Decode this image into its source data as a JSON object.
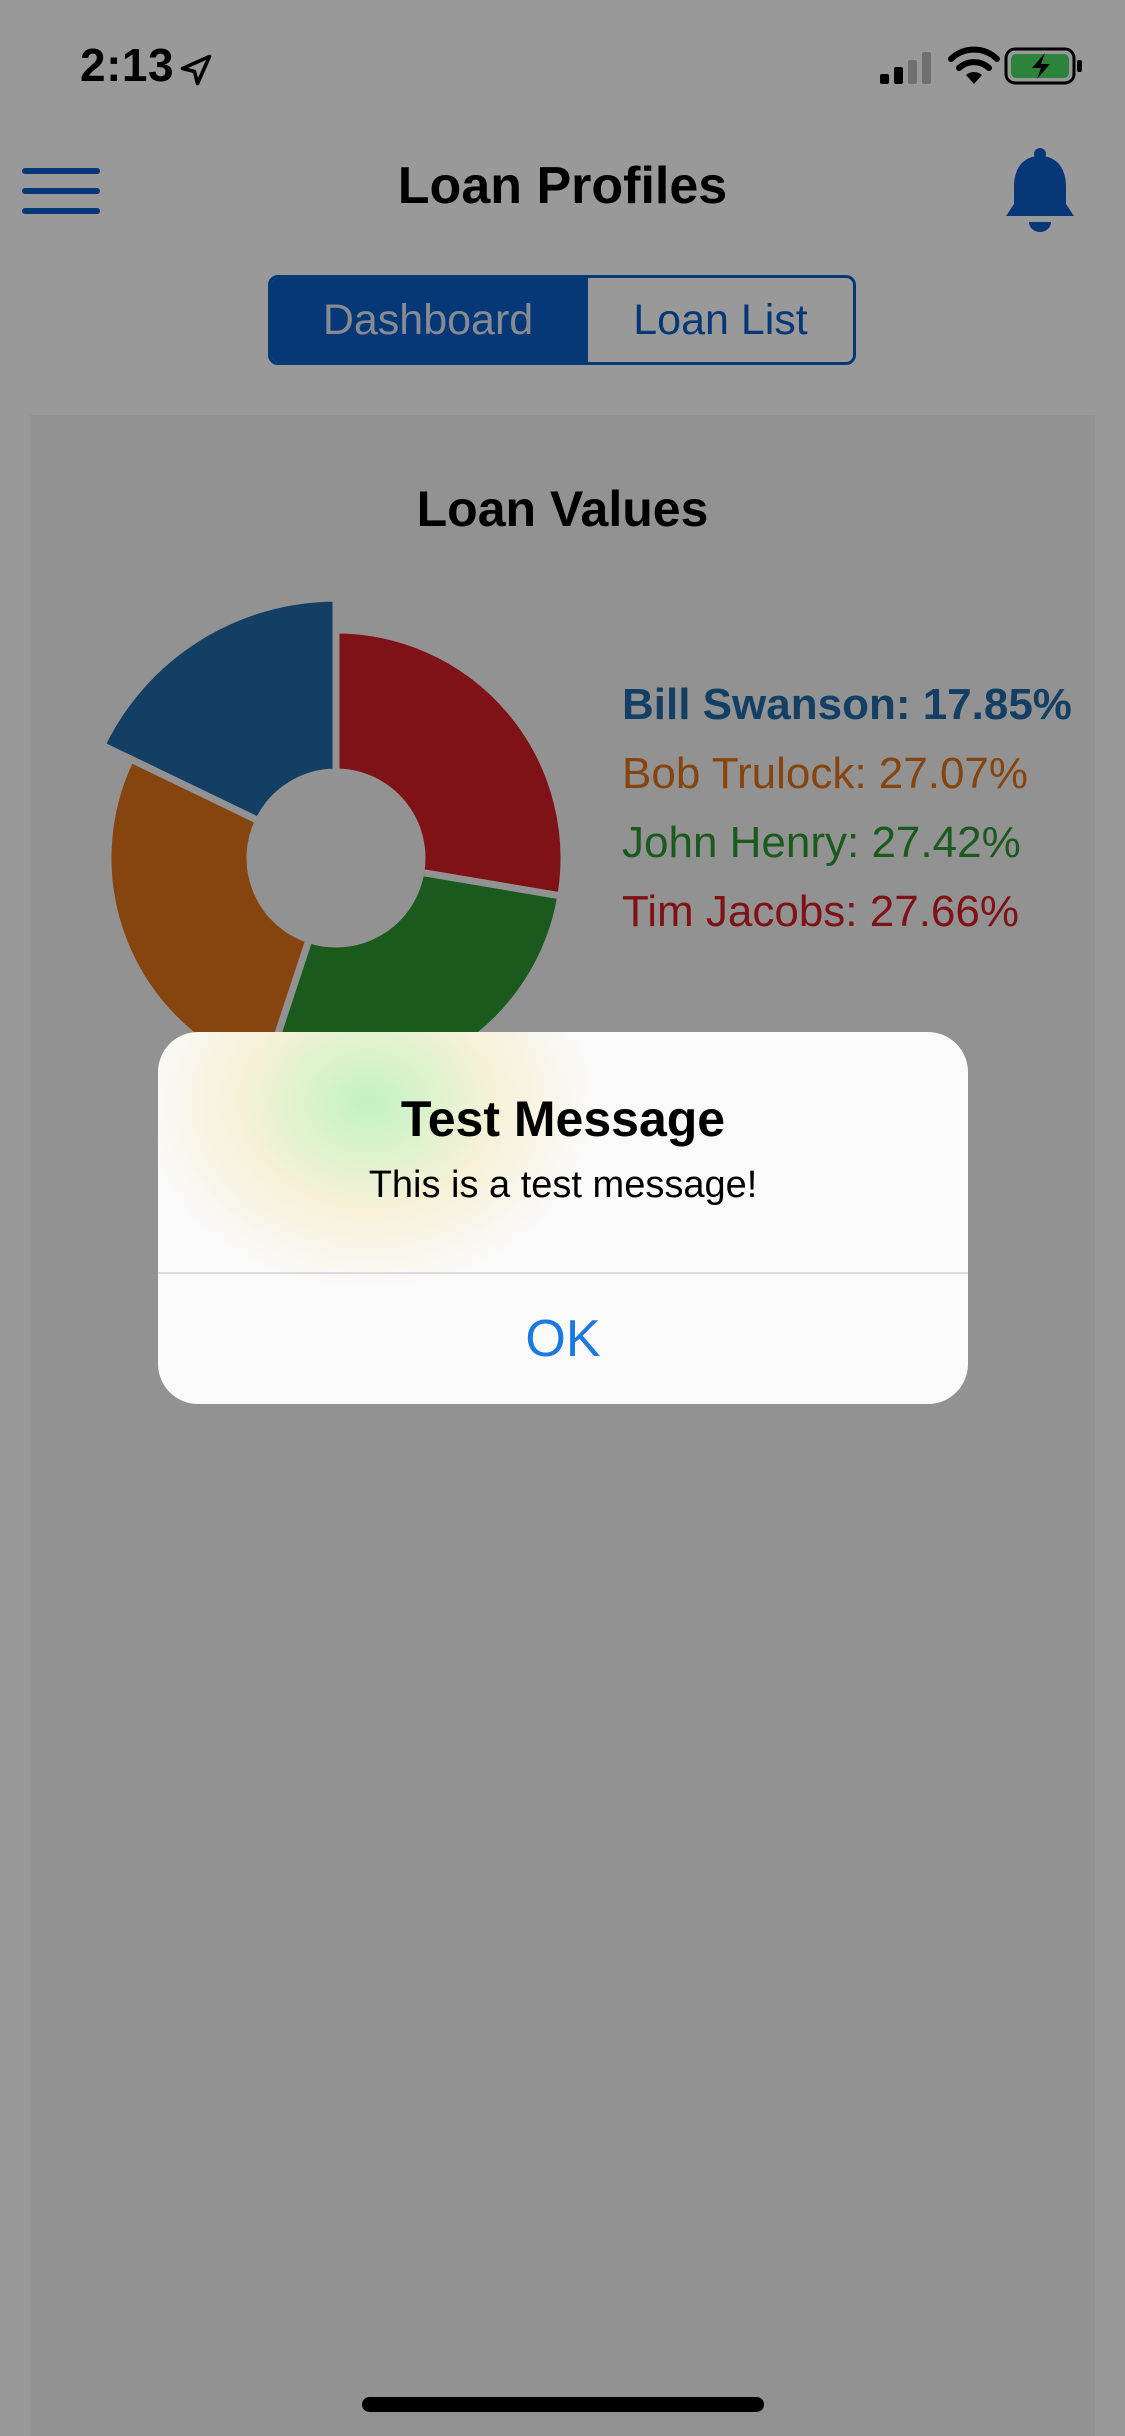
{
  "status_bar": {
    "time": "2:13"
  },
  "header": {
    "title": "Loan Profiles"
  },
  "tabs": [
    {
      "label": "Dashboard",
      "active": true
    },
    {
      "label": "Loan List",
      "active": false
    }
  ],
  "card": {
    "title": "Loan Values"
  },
  "legend": [
    {
      "label": "Bill Swanson: 17.85%"
    },
    {
      "label": "Bob Trulock: 27.07%"
    },
    {
      "label": "John Henry: 27.42%"
    },
    {
      "label": "Tim Jacobs: 27.66%"
    }
  ],
  "alert": {
    "title": "Test Message",
    "message": "This is a test message!",
    "button_label": "OK"
  },
  "colors": {
    "accent": "#0a5ec8",
    "alert_button": "#1a7ae0",
    "bill_swanson": "#1f6aa5",
    "bob_trulock": "#e0721a",
    "john_henry": "#2c9630",
    "tim_jacobs": "#d41e26"
  },
  "chart_data": {
    "type": "pie",
    "categories": [
      "Bill Swanson",
      "Bob Trulock",
      "John Henry",
      "Tim Jacobs"
    ],
    "values": [
      17.85,
      27.07,
      27.42,
      27.66
    ],
    "colors": [
      "#1f6aa5",
      "#e0721a",
      "#2c9630",
      "#d41e26"
    ],
    "title": "Loan Values",
    "donut": true,
    "legend_position": "right"
  }
}
